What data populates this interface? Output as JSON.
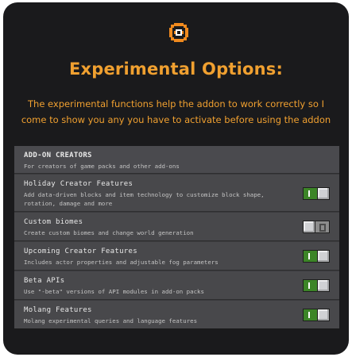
{
  "header": {
    "logo_icon": "addon-logo-icon",
    "title": "Experimental Options:",
    "subtitle": "The experimental functions help the addon to work correctly so I come to show you any you have to activate before using the addon"
  },
  "colors": {
    "accent": "#f0a030",
    "toggle_on": "#3c8527",
    "background": "#1a1a1c"
  },
  "section": {
    "title": "ADD-ON CREATORS",
    "description": "For creators of game packs and other add-ons"
  },
  "options": [
    {
      "title": "Holiday Creator Features",
      "description": "Add data-driven blocks and item technology to customize block shape, rotation, damage and more",
      "enabled": true
    },
    {
      "title": "Custom biomes",
      "description": "Create custom biomes and change world generation",
      "enabled": false
    },
    {
      "title": "Upcoming Creator Features",
      "description": "Includes actor properties and adjustable fog parameters",
      "enabled": true
    },
    {
      "title": "Beta APIs",
      "description": "Use \"-beta\" versions of API modules in add-on packs",
      "enabled": true
    },
    {
      "title": "Molang Features",
      "description": "Molang experimental queries and language features",
      "enabled": true
    }
  ]
}
